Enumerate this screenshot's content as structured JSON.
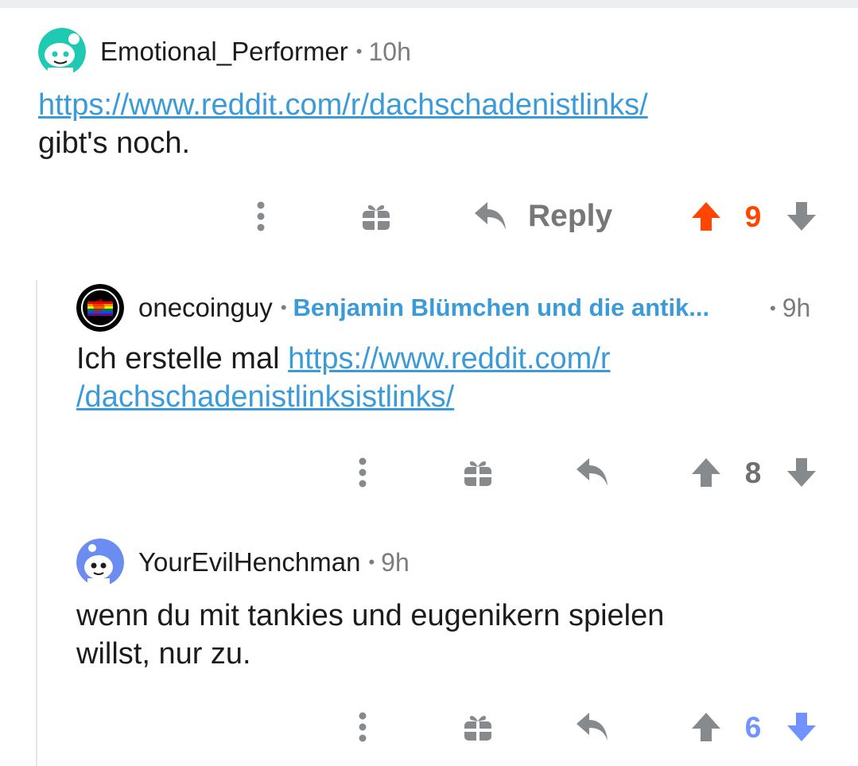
{
  "comments": [
    {
      "username": "Emotional_Performer",
      "time": "10h",
      "body_link": "https://www.reddit.com/r/dachschadenistlinks/",
      "body_text": "gibt's noch.",
      "reply_label": "Reply",
      "score": "9",
      "vote_state": "upvoted",
      "avatar_color": "#1fc9b2"
    },
    {
      "username": "onecoinguy",
      "flair": "Benjamin Blümchen und die antik...",
      "time": "9h",
      "body_text": "Ich erstelle mal ",
      "body_link_1": "https://www.reddit.com/r",
      "body_link_2": "/dachschadenistlinksistlinks/",
      "score": "8",
      "vote_state": "none",
      "avatar_color": "#000000"
    },
    {
      "username": "YourEvilHenchman",
      "time": "9h",
      "body_line_1": "wenn du mit tankies und eugenikern spielen",
      "body_line_2": "willst, nur zu.",
      "score": "6",
      "vote_state": "downvoted",
      "avatar_color": "#6b8cf0"
    }
  ],
  "colors": {
    "upvote": "#ff4500",
    "downvote": "#7193ff",
    "link": "#3a9bd8",
    "icon_gray": "#878a8c"
  },
  "icons": [
    "more-options-icon",
    "award-gift-icon",
    "reply-arrow-icon",
    "upvote-arrow-icon",
    "downvote-arrow-icon"
  ]
}
